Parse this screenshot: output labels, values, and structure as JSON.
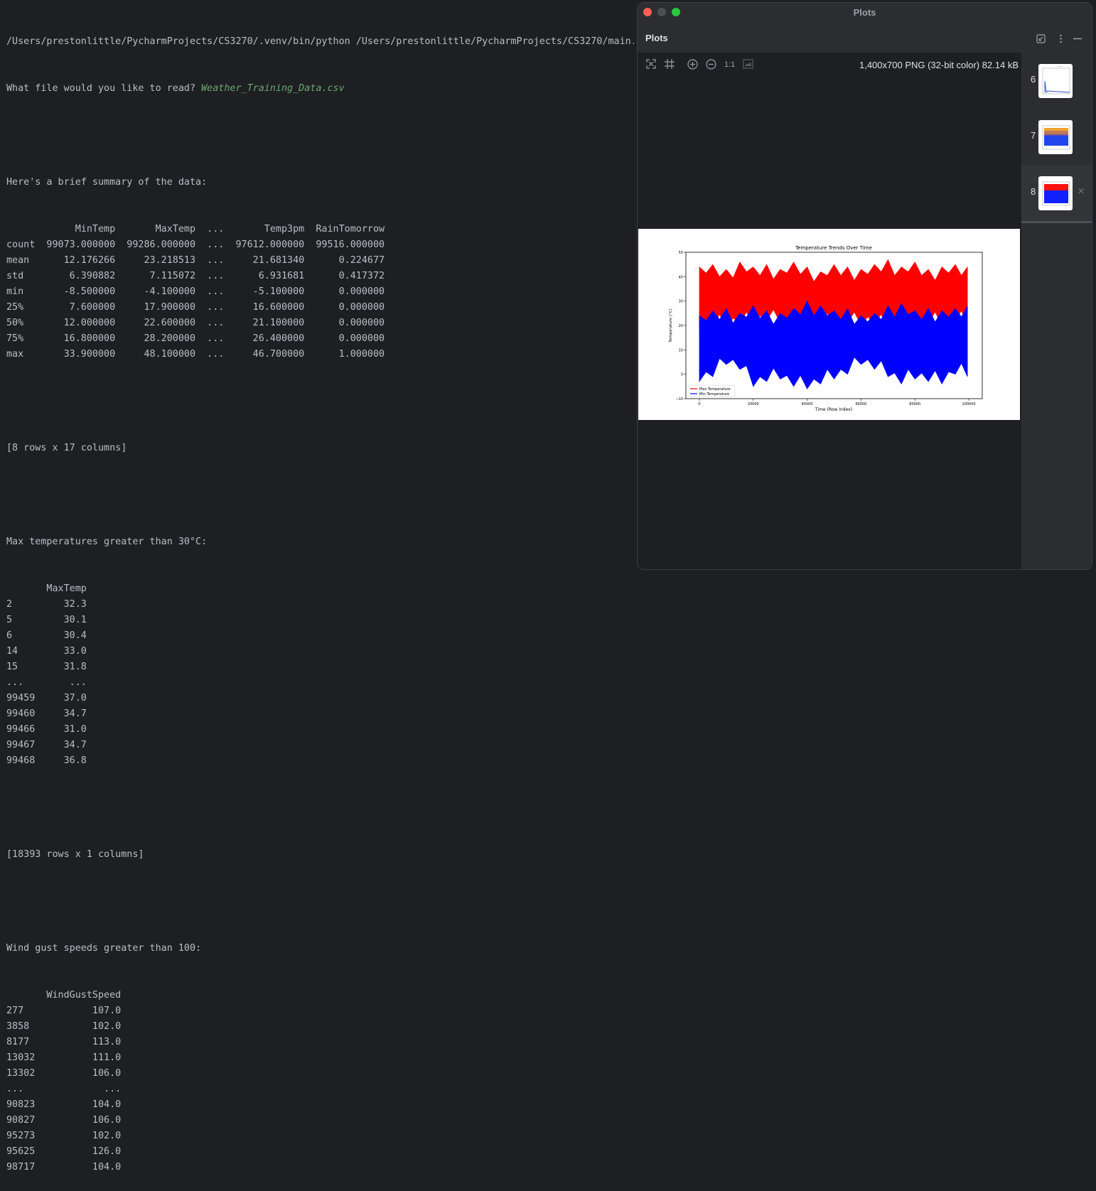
{
  "console": {
    "command": "/Users/prestonlittle/PycharmProjects/CS3270/.venv/bin/python /Users/prestonlittle/PycharmProjects/CS3270/main.py",
    "prompt": "What file would you like to read? ",
    "prompt_answer": "Weather_Training_Data.csv",
    "summary_heading": "Here's a brief summary of the data:",
    "summary_table": [
      "            MinTemp       MaxTemp  ...       Temp3pm  RainTomorrow",
      "count  99073.000000  99286.000000  ...  97612.000000  99516.000000",
      "mean      12.176266     23.218513  ...     21.681340      0.224677",
      "std        6.390882      7.115072  ...      6.931681      0.417372",
      "min       -8.500000     -4.100000  ...     -5.100000      0.000000",
      "25%        7.600000     17.900000  ...     16.600000      0.000000",
      "50%       12.000000     22.600000  ...     21.100000      0.000000",
      "75%       16.800000     28.200000  ...     26.400000      0.000000",
      "max       33.900000     48.100000  ...     46.700000      1.000000"
    ],
    "summary_shape": "[8 rows x 17 columns]",
    "maxtemp_heading": "Max temperatures greater than 30°C:",
    "maxtemp_table": [
      "       MaxTemp",
      "2         32.3",
      "5         30.1",
      "6         30.4",
      "14        33.0",
      "15        31.8",
      "...        ...",
      "99459     37.0",
      "99460     34.7",
      "99466     31.0",
      "99467     34.7",
      "99468     36.8"
    ],
    "maxtemp_shape": "[18393 rows x 1 columns]",
    "wind_heading": "Wind gust speeds greater than 100:",
    "wind_table": [
      "       WindGustSpeed",
      "277            107.0",
      "3858           102.0",
      "8177           113.0",
      "13032          111.0",
      "13302          106.0",
      "...              ...",
      "90823          104.0",
      "90827          106.0",
      "95273          102.0",
      "95625          126.0",
      "98717          104.0"
    ]
  },
  "plots_window": {
    "title": "Plots",
    "panel_title": "Plots",
    "zoom_actual_label": "1:1",
    "image_info": "1,400x700 PNG (32-bit color) 82.14 kB",
    "thumbnails": [
      {
        "number": "6"
      },
      {
        "number": "7"
      },
      {
        "number": "8"
      }
    ]
  },
  "colors": {
    "max_series": "#ff0000",
    "min_series": "#0000ff",
    "close_light": "#ff5f57",
    "minimize_light": "#4d4e52",
    "zoom_light": "#28c840"
  },
  "chart_data": {
    "type": "line",
    "title": "Temperature Trends Over Time",
    "xlabel": "Time (Row Index)",
    "ylabel": "Temperature (°C)",
    "xlim": [
      -5000,
      105000
    ],
    "ylim": [
      -10,
      50
    ],
    "xticks": [
      "0",
      "20000",
      "40000",
      "60000",
      "80000",
      "100000"
    ],
    "yticks": [
      "−10",
      "0",
      "10",
      "20",
      "30",
      "40",
      "50"
    ],
    "legend_position": "lower-left",
    "legend": [
      "Max Temperature",
      "Min Temperature"
    ],
    "series": [
      {
        "name": "Max Temperature",
        "color": "#ff0000",
        "x": [
          0,
          5000,
          10000,
          15000,
          20000,
          25000,
          30000,
          35000,
          40000,
          45000,
          50000,
          55000,
          60000,
          65000,
          70000,
          75000,
          80000,
          85000,
          90000,
          95000,
          99500
        ],
        "low": [
          18,
          20,
          19,
          21,
          20,
          22,
          21,
          18,
          20,
          21,
          19,
          21,
          20,
          21,
          18,
          20,
          19,
          21,
          20,
          22,
          20
        ],
        "high": [
          44,
          45,
          43,
          46,
          44,
          45,
          43,
          46,
          44,
          42,
          45,
          44,
          43,
          45,
          47,
          44,
          46,
          43,
          44,
          45,
          44
        ]
      },
      {
        "name": "Min Temperature",
        "color": "#0000ff",
        "x": [
          0,
          5000,
          10000,
          15000,
          20000,
          25000,
          30000,
          35000,
          40000,
          45000,
          50000,
          55000,
          60000,
          65000,
          70000,
          75000,
          80000,
          85000,
          90000,
          95000,
          99500
        ],
        "low": [
          -3,
          -1,
          4,
          2,
          -5,
          -3,
          -2,
          -5,
          -6,
          -4,
          -2,
          0,
          4,
          2,
          -1,
          -4,
          -2,
          -3,
          -4,
          0,
          -1
        ],
        "high": [
          24,
          26,
          27,
          25,
          28,
          26,
          25,
          27,
          30,
          28,
          26,
          27,
          24,
          25,
          28,
          29,
          26,
          27,
          26,
          27,
          28
        ]
      }
    ]
  }
}
